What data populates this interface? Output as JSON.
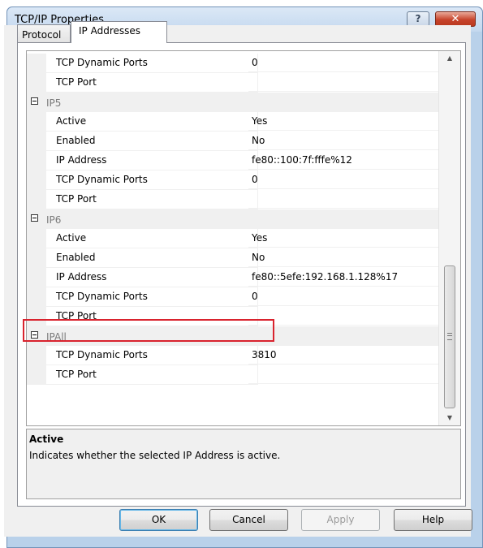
{
  "window": {
    "title": "TCP/IP Properties",
    "help_glyph": "?",
    "close_glyph": "✕"
  },
  "tabs": [
    {
      "label": "Protocol"
    },
    {
      "label": "IP Addresses"
    }
  ],
  "grid": {
    "rows": [
      {
        "type": "prop",
        "name": "TCP Dynamic Ports",
        "value": "0"
      },
      {
        "type": "prop",
        "name": "TCP Port",
        "value": ""
      },
      {
        "type": "category",
        "name": "IP5"
      },
      {
        "type": "prop",
        "name": "Active",
        "value": "Yes"
      },
      {
        "type": "prop",
        "name": "Enabled",
        "value": "No"
      },
      {
        "type": "prop",
        "name": "IP Address",
        "value": "fe80::100:7f:fffe%12"
      },
      {
        "type": "prop",
        "name": "TCP Dynamic Ports",
        "value": "0"
      },
      {
        "type": "prop",
        "name": "TCP Port",
        "value": ""
      },
      {
        "type": "category",
        "name": "IP6"
      },
      {
        "type": "prop",
        "name": "Active",
        "value": "Yes"
      },
      {
        "type": "prop",
        "name": "Enabled",
        "value": "No"
      },
      {
        "type": "prop",
        "name": "IP Address",
        "value": "fe80::5efe:192.168.1.128%17"
      },
      {
        "type": "prop",
        "name": "TCP Dynamic Ports",
        "value": "0"
      },
      {
        "type": "prop",
        "name": "TCP Port",
        "value": ""
      },
      {
        "type": "category",
        "name": "IPAll"
      },
      {
        "type": "prop",
        "name": "TCP Dynamic Ports",
        "value": "3810"
      },
      {
        "type": "prop",
        "name": "TCP Port",
        "value": ""
      }
    ]
  },
  "scrollbar": {
    "up_glyph": "▲",
    "down_glyph": "▼"
  },
  "description": {
    "title": "Active",
    "text": "Indicates whether the selected IP Address is active."
  },
  "buttons": {
    "ok": "OK",
    "cancel": "Cancel",
    "apply": "Apply",
    "help": "Help"
  },
  "colors": {
    "highlight": "#d9232e",
    "category_text": "#7a7a7a",
    "title_bar": "#c4d8ef"
  }
}
